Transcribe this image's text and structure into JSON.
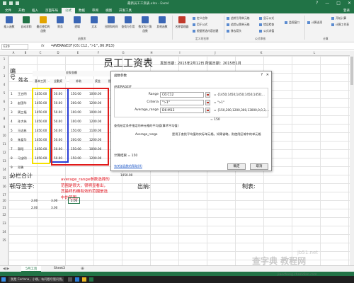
{
  "window": {
    "title": "最新员工工资表.xlsx - Excel",
    "controls": [
      "?",
      "—",
      "□",
      "✕"
    ]
  },
  "ribbon": {
    "tabs": [
      "文件",
      "开始",
      "插入",
      "页面布局",
      "公式",
      "数据",
      "审阅",
      "视图",
      "开发工具"
    ],
    "active_tab": "公式",
    "user": "登录",
    "buttons": [
      {
        "label": "插入函数",
        "icon": "fx-icon",
        "color": "#3a66b5"
      },
      {
        "label": "自动求和",
        "icon": "sum-icon",
        "color": "#217346"
      },
      {
        "label": "最近使用的函数",
        "icon": "star-icon",
        "color": "#e2a400"
      },
      {
        "label": "财务",
        "icon": "book-icon",
        "color": "#3a66b5"
      },
      {
        "label": "逻辑",
        "icon": "book-icon",
        "color": "#3a66b5"
      },
      {
        "label": "文本",
        "icon": "book-icon",
        "color": "#3a66b5"
      },
      {
        "label": "日期和时间",
        "icon": "clock-icon",
        "color": "#3a66b5"
      },
      {
        "label": "查找与引用",
        "icon": "book-icon",
        "color": "#3a66b5"
      },
      {
        "label": "数学和三角函数",
        "icon": "theta-icon",
        "color": "#3a66b5"
      },
      {
        "label": "其他函数",
        "icon": "more-icon",
        "color": "#3a66b5"
      },
      {
        "label": "名称管理器",
        "icon": "tag-icon",
        "color": "#c0392b"
      }
    ],
    "small_buttons": [
      "定义名称",
      "用于公式",
      "根据所选内容创建",
      "追踪引用单元格",
      "追踪从属单元格",
      "移去箭头",
      "显示公式",
      "错误检查",
      "公式求值",
      "监视窗口",
      "计算选项",
      "开始计算",
      "计算工作表"
    ],
    "groups": [
      "函数库",
      "定义的名称",
      "公式审核",
      "计算"
    ]
  },
  "formula_bar": {
    "name_box": "E20",
    "fx": "fx",
    "formula": "=AVERAGEIF(C6:C12,\">1\",D6:M13)"
  },
  "sheet": {
    "col_headers": [
      "A",
      "B",
      "C",
      "D",
      "E",
      "F",
      "G",
      "H",
      "I",
      "J",
      "K",
      "L"
    ],
    "row_headers": [
      "1",
      "2",
      "3",
      "4",
      "5",
      "6",
      "7",
      "8",
      "9",
      "10",
      "11",
      "12",
      "13",
      "14",
      "15",
      "16",
      "17",
      "18",
      "19",
      "20",
      "21",
      "22",
      "23",
      "24",
      "25"
    ],
    "title": "员工工资表",
    "meta": "发放日期：2015年2月12日  所属日期：2015年1月",
    "label_bianhao": "编号",
    "label_xingming": "姓名",
    "header_group": "应发金额",
    "headers": [
      "基本工资",
      "全勤奖",
      "补助",
      "奖金",
      "提成"
    ],
    "row_numbers": [
      "1",
      "2",
      "3",
      "4",
      "5",
      "6",
      "7",
      "8",
      "9",
      "10",
      "11"
    ],
    "names": [
      "王五明",
      "赵国华",
      "周三福",
      "孙大伟",
      "马达彬",
      "朱爱华",
      "郭阳",
      "马宝明",
      "邓勇"
    ],
    "base_salary": [
      "1450.00",
      "1450.00",
      "1450.00",
      "1450.00",
      "1450.00",
      "1450.00",
      "1450.00",
      "1450.00"
    ],
    "attendance": [
      "50.00",
      "50.00",
      "50.00",
      "50.00",
      "50.00",
      "50.00",
      "50.00",
      "50.00"
    ],
    "allowance": [
      "150.00",
      "200.00",
      "100.00",
      "100.00",
      "150.00",
      "200.00",
      "150.00",
      "150.00"
    ],
    "bonus": [
      "1000.00",
      "1200.00",
      "1000.00",
      "1200.00",
      "1100.00",
      "1200.00",
      "1000.00",
      "1200.00"
    ],
    "subtotal_label": "分栏合计",
    "subtotal_value": "1450.00",
    "sign_labels": [
      "领导签字:",
      "出纳:",
      "制表:"
    ],
    "row20": [
      "2.00",
      "3.00"
    ],
    "row21": [
      "2.00",
      "3.00"
    ],
    "selected_cell": "2.00",
    "box_colors": {
      "yellow": "#f5e000",
      "blue": "#2a3fd6",
      "red": "#e01a1a"
    }
  },
  "dialog": {
    "title": "函数参数",
    "help": "?",
    "close": "✕",
    "function": "AVERAGEIF",
    "args": [
      {
        "label": "Range",
        "value": "C6:C12",
        "result": "= {1450;1450;1450;1450;1450;..."
      },
      {
        "label": "Criteria",
        "value": "\">1\"",
        "result": "= \">1\""
      },
      {
        "label": "Average_range",
        "value": "D6:M13",
        "result": "= {150,200,1200,300,13000,0,0,3,..."
      }
    ],
    "result_eq": "= 150",
    "description": "查找给定条件指定的单元格的平均值(算术平均值)",
    "arg_name": "Average_range",
    "arg_description": "是用于查找平均值的实际单元格。如果省略，则使用区域中的单元格",
    "calc_result": "计算结果 =  150",
    "help_link": "有关该函数的帮助(H)",
    "ok": "确定",
    "cancel": "取消"
  },
  "annotation": "average_range参数选择的范围是很大，很明显看出，其最终的确有效的范围是选中的范围。",
  "sheet_tabs": [
    "5月工资",
    "Sheet3"
  ],
  "active_sheet": "5月工资",
  "taskbar": {
    "search_placeholder": "我是 Cortana，小娜。有问题尽管问我。"
  },
  "watermark": "查字典 教程网",
  "watermark_url": "jiaocheng.chazidian.com",
  "watermark_site": "jb51.net"
}
